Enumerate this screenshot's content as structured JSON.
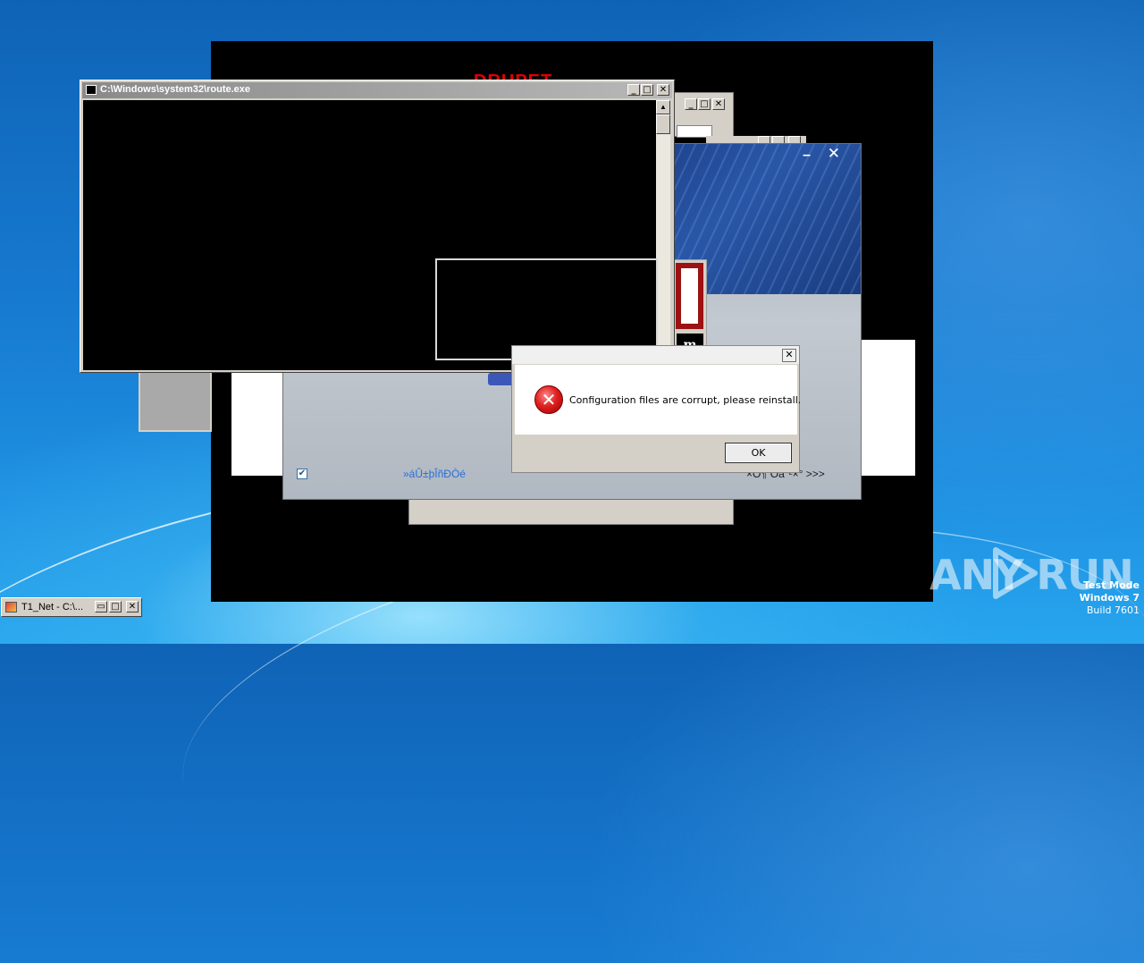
{
  "background_windows": {
    "red_banner_text": "DRUPET",
    "installer": {
      "checkbox_mark": "✔",
      "link_text": "»áÛ±þÎñÐ­Òé",
      "next_text": "×Ô¶¨Òå°²×° >>>",
      "minimize_glyph": "–",
      "close_glyph": "✕"
    },
    "app_icon_letter": "m"
  },
  "console_window": {
    "title": "C:\\Windows\\system32\\route.exe",
    "buttons": {
      "minimize": "_",
      "maximize": "□",
      "close": "✕"
    }
  },
  "error_dialog": {
    "message": "Configuration files are corrupt, please reinstall.",
    "ok_label": "OK",
    "close_glyph": "✕",
    "icon": "error-icon"
  },
  "taskbar_window": {
    "title": "T1_Net - C:\\...",
    "buttons": {
      "restore": "▭",
      "maximize": "□",
      "close": "✕"
    }
  },
  "watermark": {
    "text": "ANY RUN"
  },
  "system_info": {
    "line1": "Test Mode",
    "line2": "Windows 7",
    "line3": "Build 7601"
  },
  "colors": {
    "desktop_blue": "#1679cf",
    "error_red": "#e02020",
    "console_black": "#000000"
  }
}
